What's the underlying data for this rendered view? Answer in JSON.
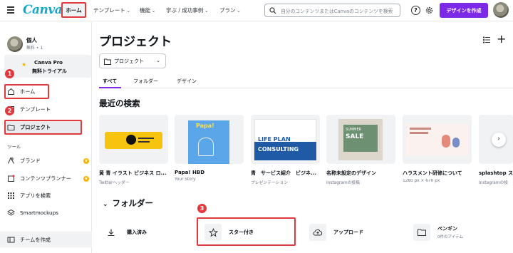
{
  "topbar": {
    "logo": "Canva",
    "home": "ホーム",
    "template": "テンプレート",
    "features": "機能",
    "learn": "学ぶ / 成功事例",
    "plan": "プラン",
    "search_placeholder": "自分のコンテンツまたはCanvaのコンテンツを検索",
    "help": "?",
    "create_design": "デザインを作成"
  },
  "sidebar": {
    "user_name": "個人",
    "user_sub": "無料 • 1",
    "pro_line1": "Canva Pro",
    "pro_line2": "無料トライアル",
    "home": "ホーム",
    "template": "テンプレート",
    "project": "プロジェクト",
    "tools_heading": "ツール",
    "brand": "ブランド",
    "content_planner": "コンテンツプランナー",
    "apps": "アプリを検索",
    "smartmockups": "Smartmockups",
    "create_team": "チームを作成"
  },
  "badges": {
    "one": "1",
    "two": "2",
    "three": "3"
  },
  "main": {
    "title": "プロジェクト",
    "dropdown": "プロジェクト",
    "tabs": [
      "すべて",
      "フォルダー",
      "デザイン"
    ],
    "recent_title": "最近の検索",
    "folders_title": "フォルダー"
  },
  "recent": [
    {
      "title": "黄 青 イラスト ビジネス ロ...",
      "sub": "Twitterヘッダー"
    },
    {
      "title": "Papa! HBD",
      "sub": "Your Story",
      "thumb_text": "Papa!"
    },
    {
      "title": "青　サービス紹介　ビジネ...",
      "sub": "プレゼンテーション",
      "thumb_text_1": "LIFE PLAN",
      "thumb_text_2": "CONSULTING"
    },
    {
      "title": "名称未設定のデザイン",
      "sub": "Instagramの投稿",
      "thumb_text_1": "SUMMER",
      "thumb_text_2": "SALE"
    },
    {
      "title": "ハラスメント研修について",
      "sub": "1280 px × 670 px"
    },
    {
      "title": "splashtop ス",
      "sub": "Instagramの投"
    }
  ],
  "folders": [
    {
      "label": "購入済み",
      "sub": ""
    },
    {
      "label": "スター付き",
      "sub": ""
    },
    {
      "label": "アップロード",
      "sub": ""
    },
    {
      "label": "ペンギン",
      "sub": "0件のアイテム"
    }
  ],
  "colors": {
    "accent": "#7d2ae8",
    "highlight": "#e0393e",
    "brand": "#15a8c8"
  }
}
